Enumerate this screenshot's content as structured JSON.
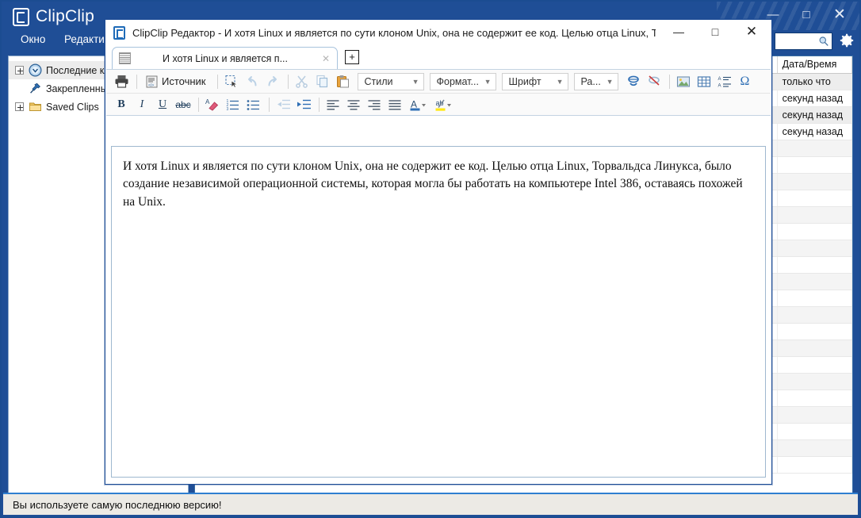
{
  "app": {
    "name": "ClipClip",
    "logo_icon": "clipclip-logo-icon",
    "window_controls": {
      "minimize": "—",
      "maximize": "□",
      "close": "✕"
    },
    "menu": [
      {
        "label": "Окно",
        "name": "menu-window"
      },
      {
        "label": "Редактир",
        "name": "menu-editor"
      }
    ],
    "search": {
      "value": "",
      "placeholder": "",
      "icon": "search-icon"
    },
    "settings_icon": "gear-icon",
    "statusbar": "Вы используете самую последнюю версию!"
  },
  "tree": {
    "items": [
      {
        "label": "Последние клипы",
        "icon": "clock-icon",
        "expandable": true,
        "selected": true
      },
      {
        "label": "Закрепленные",
        "icon": "pin-icon",
        "expandable": false,
        "selected": false
      },
      {
        "label": "Saved Clips",
        "icon": "folder-icon",
        "expandable": true,
        "selected": false
      }
    ]
  },
  "list": {
    "columns": [
      "",
      "Дата/Время"
    ],
    "rows": [
      {
        "cells": [
          "",
          "только что"
        ],
        "highlighted": false
      },
      {
        "cells": [
          "",
          "секунд назад"
        ],
        "highlighted": false
      },
      {
        "cells": [
          "",
          "секунд назад"
        ],
        "highlighted": true
      },
      {
        "cells": [
          "",
          "секунд назад"
        ],
        "highlighted": false
      }
    ]
  },
  "editor": {
    "title": "ClipClip Редактор - И хотя Linux и является по сути клоном Unix, она не содержит ее код. Целью отца Linux, Торвальдса ...",
    "window_controls": {
      "minimize": "—",
      "maximize": "□",
      "close": "✕"
    },
    "tab": {
      "label": "И хотя Linux и является п...",
      "icon": "document-icon",
      "close": "✕"
    },
    "new_tab_label": "+",
    "toolbar_row1": [
      {
        "name": "print-button",
        "label": "",
        "icon": "printer-icon",
        "type": "icon"
      },
      {
        "type": "separator"
      },
      {
        "name": "source-button",
        "label": "Источник",
        "icon": "source-code-icon",
        "type": "icon-text"
      },
      {
        "type": "separator"
      },
      {
        "name": "select-all-button",
        "label": "",
        "icon": "select-all-icon",
        "type": "icon"
      },
      {
        "name": "undo-button",
        "label": "",
        "icon": "undo-icon",
        "type": "icon"
      },
      {
        "name": "redo-button",
        "label": "",
        "icon": "redo-icon",
        "type": "icon"
      },
      {
        "type": "separator"
      },
      {
        "name": "cut-button",
        "label": "",
        "icon": "scissors-icon",
        "type": "icon"
      },
      {
        "name": "copy-button",
        "label": "",
        "icon": "copy-icon",
        "type": "icon"
      },
      {
        "name": "paste-button",
        "label": "",
        "icon": "paste-icon",
        "type": "icon"
      }
    ],
    "dropdowns": [
      {
        "name": "styles-dropdown",
        "value": "Стили"
      },
      {
        "name": "format-dropdown",
        "value": "Формат..."
      },
      {
        "name": "font-dropdown",
        "value": "Шрифт"
      },
      {
        "name": "size-dropdown",
        "value": "Ра..."
      }
    ],
    "toolbar_row1_tail": [
      {
        "name": "link-button",
        "icon": "link-icon"
      },
      {
        "name": "unlink-button",
        "icon": "unlink-icon"
      },
      {
        "type": "separator"
      },
      {
        "name": "image-button",
        "icon": "image-icon"
      },
      {
        "name": "table-button",
        "icon": "table-icon"
      },
      {
        "name": "page-break-button",
        "icon": "page-break-icon"
      },
      {
        "name": "special-char-button",
        "icon": "omega-icon"
      }
    ],
    "toolbar_row2": [
      {
        "name": "bold-button",
        "label": "B",
        "icon": "bold-icon"
      },
      {
        "name": "italic-button",
        "label": "I",
        "icon": "italic-icon"
      },
      {
        "name": "underline-button",
        "label": "U",
        "icon": "underline-icon"
      },
      {
        "name": "strikethrough-button",
        "label": "abc",
        "icon": "strikethrough-icon"
      },
      {
        "type": "separator"
      },
      {
        "name": "remove-format-button",
        "icon": "eraser-icon"
      },
      {
        "name": "numbered-list-button",
        "icon": "numbered-list-icon"
      },
      {
        "name": "bulleted-list-button",
        "icon": "bulleted-list-icon"
      },
      {
        "type": "separator"
      },
      {
        "name": "outdent-button",
        "icon": "outdent-icon"
      },
      {
        "name": "indent-button",
        "icon": "indent-icon"
      },
      {
        "type": "separator"
      },
      {
        "name": "align-left-button",
        "icon": "align-left-icon"
      },
      {
        "name": "align-center-button",
        "icon": "align-center-icon"
      },
      {
        "name": "align-right-button",
        "icon": "align-right-icon"
      },
      {
        "name": "align-justify-button",
        "icon": "align-justify-icon"
      },
      {
        "name": "text-color-button",
        "icon": "text-color-icon"
      },
      {
        "name": "highlight-color-button",
        "icon": "highlight-color-icon"
      }
    ],
    "content": "И хотя Linux и является по сути клоном Unix, она не содержит ее код. Целью отца Linux, Торвальдса Линукса, было создание независимой операционной системы, которая могла бы работать на компьютере Intel 386, оставаясь похожей на Unix."
  },
  "colors": {
    "brand_blue": "#1f4e96",
    "accent_blue": "#2f7fd0",
    "panel_white": "#ffffff",
    "status_bg": "#eceae5"
  }
}
